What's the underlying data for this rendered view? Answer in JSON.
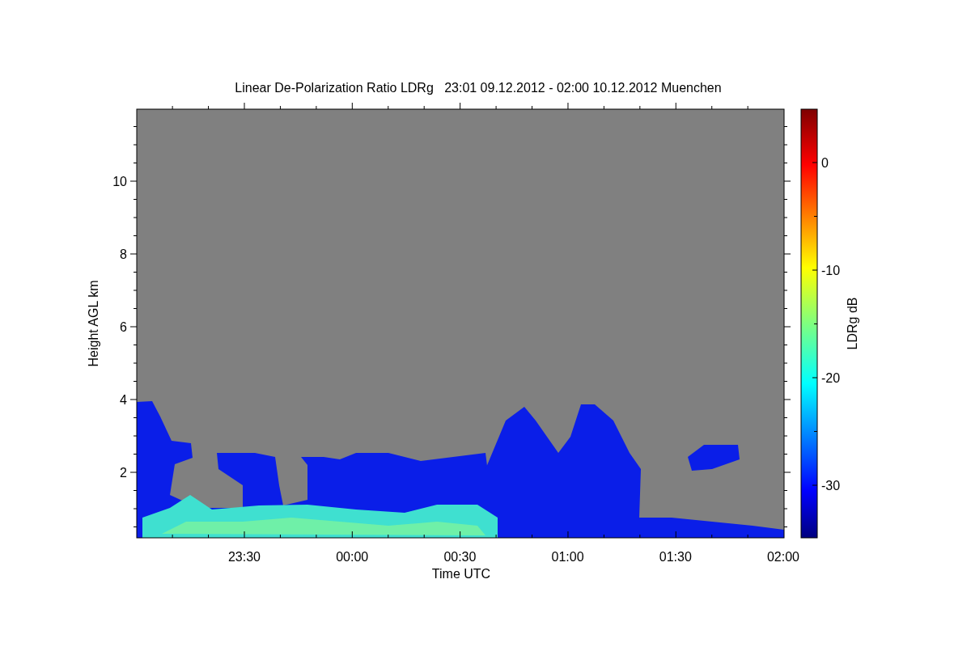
{
  "title": "Linear De-Polarization Ratio LDRg   23:01 09.12.2012 - 02:00 10.12.2012 Muenchen",
  "y_axis": {
    "label": "Height AGL km",
    "ticks": [
      "10",
      "8",
      "6",
      "4",
      "2"
    ]
  },
  "x_axis": {
    "label": "Time UTC",
    "ticks": [
      "23:30",
      "00:00",
      "00:30",
      "01:00",
      "01:30",
      "02:00"
    ]
  },
  "colorbar": {
    "label": "LDRg dB",
    "ticks": [
      "0",
      "-10",
      "-20",
      "-30"
    ]
  }
}
